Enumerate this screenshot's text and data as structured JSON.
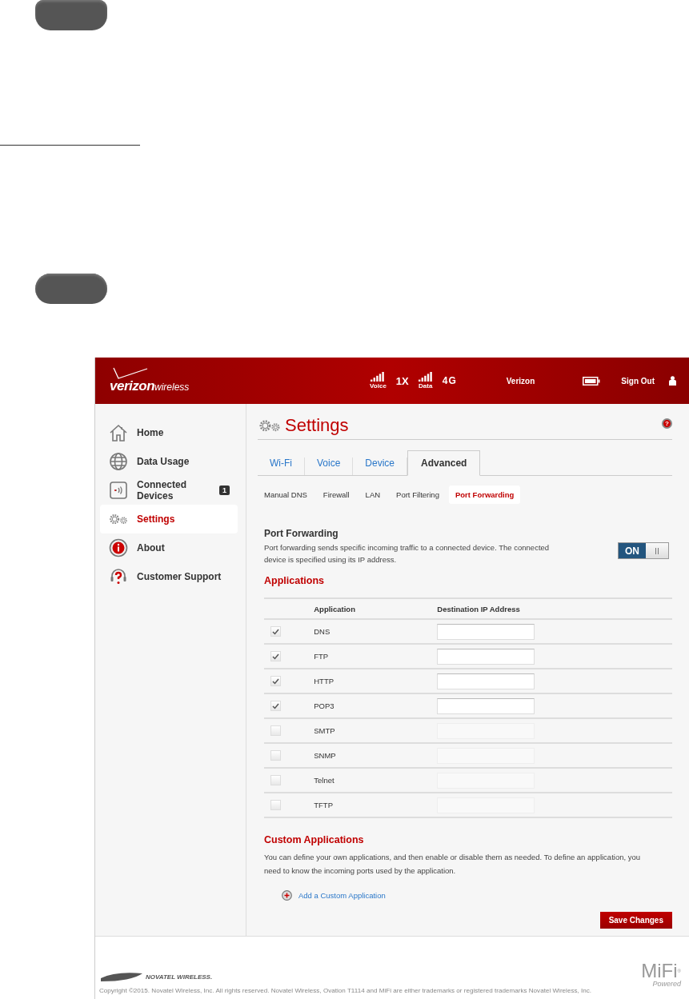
{
  "header": {
    "logo": {
      "brand": "verizon",
      "suffix": "wireless"
    },
    "status_items": [
      {
        "kind": "signal",
        "label": "Voice"
      },
      {
        "kind": "text",
        "label": "1X"
      },
      {
        "kind": "signal",
        "label": "Data"
      },
      {
        "kind": "network",
        "label": "4G"
      }
    ],
    "carrier": "Verizon",
    "sign_out": "Sign Out"
  },
  "sidebar": {
    "items": [
      {
        "label": "Home",
        "selected": false
      },
      {
        "label": "Data Usage",
        "selected": false
      },
      {
        "label": "Connected Devices",
        "selected": false,
        "badge": "1"
      },
      {
        "label": "Settings",
        "selected": true
      },
      {
        "label": "About",
        "selected": false
      },
      {
        "label": "Customer Support",
        "selected": false
      }
    ]
  },
  "page": {
    "title": "Settings",
    "help": "?",
    "tabs": [
      {
        "label": "Wi-Fi",
        "selected": false
      },
      {
        "label": "Voice",
        "selected": false
      },
      {
        "label": "Device",
        "selected": false
      },
      {
        "label": "Advanced",
        "selected": true
      }
    ],
    "subtabs": [
      {
        "label": "Manual DNS",
        "selected": false
      },
      {
        "label": "Firewall",
        "selected": false
      },
      {
        "label": "LAN",
        "selected": false
      },
      {
        "label": "Port Filtering",
        "selected": false
      },
      {
        "label": "Port Forwarding",
        "selected": true
      }
    ],
    "section": {
      "title": "Port Forwarding",
      "description": "Port forwarding sends specific incoming traffic to a connected device. The connected device is specified using its IP address.",
      "toggle": {
        "label": "ON",
        "on": true
      }
    },
    "applications": {
      "title": "Applications",
      "columns": [
        "Application",
        "Destination IP Address"
      ],
      "rows": [
        {
          "name": "DNS",
          "checked": true
        },
        {
          "name": "FTP",
          "checked": true
        },
        {
          "name": "HTTP",
          "checked": true
        },
        {
          "name": "POP3",
          "checked": true
        },
        {
          "name": "SMTP",
          "checked": false
        },
        {
          "name": "SNMP",
          "checked": false
        },
        {
          "name": "Telnet",
          "checked": false
        },
        {
          "name": "TFTP",
          "checked": false
        }
      ]
    },
    "custom": {
      "title": "Custom Applications",
      "description": "You can define your own applications, and then enable or disable them as needed. To define an application, you need to know the incoming ports used by the application.",
      "add_link": "Add a Custom Application"
    },
    "save_button": "Save Changes"
  },
  "footer": {
    "brand": "NOVATEL WIRELESS.",
    "copyright": "Copyright ©2015. Novatel Wireless, Inc. All rights reserved. Novatel Wireless, Ovation T1114 and MiFi are either trademarks or registered trademarks Novatel Wireless, Inc.",
    "mifi": {
      "name": "MiFi",
      "mark": "®",
      "tagline": "Powered"
    }
  }
}
